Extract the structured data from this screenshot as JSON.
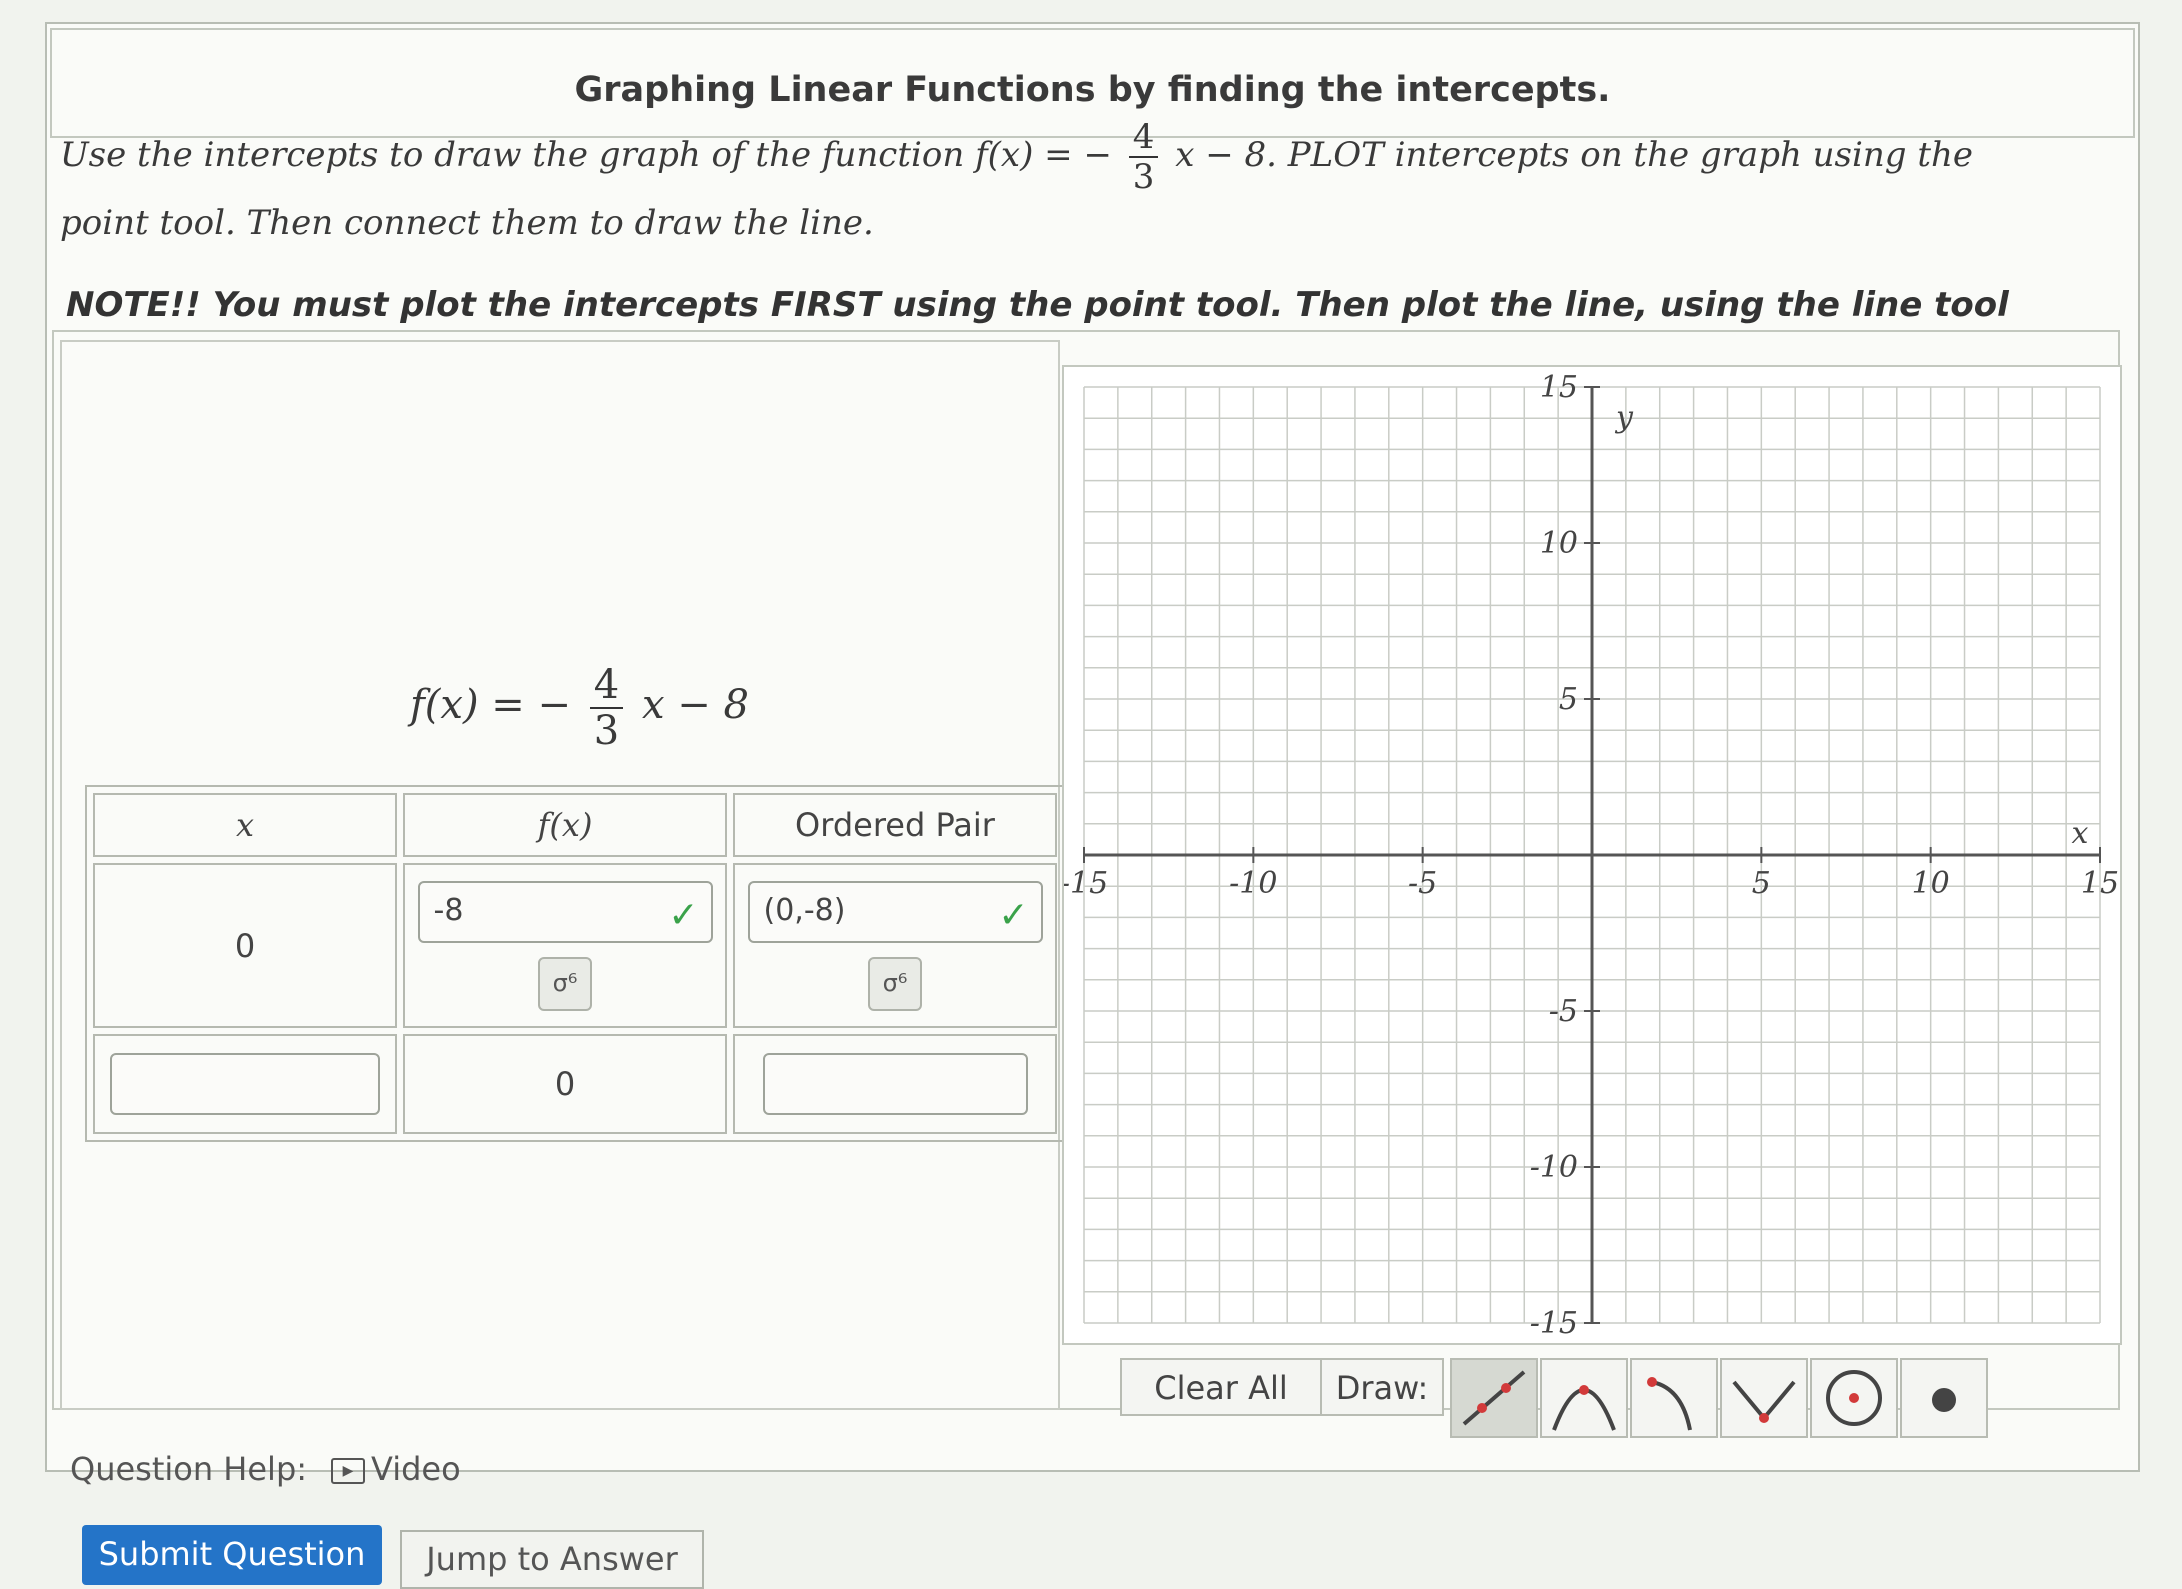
{
  "header": {
    "title": "Graphing Linear Functions by finding the intercepts."
  },
  "instructions": {
    "part1": "Use the intercepts to draw the graph of the function",
    "fx": "f(x) =",
    "minus": "−",
    "num": "4",
    "den": "3",
    "xterm": "x − 8",
    "part2": ". PLOT intercepts on the graph using the point tool. Then connect them to draw the line."
  },
  "note": "NOTE!! You must plot the intercepts FIRST using the point tool. Then plot the line, using the line tool",
  "function_display": {
    "lhs": "f(x) = −",
    "num": "4",
    "den": "3",
    "rhs": "x − 8"
  },
  "table": {
    "headers": [
      "x",
      "f(x)",
      "Ordered Pair"
    ],
    "row1": {
      "x": "0",
      "fx": "-8",
      "pair": "(0,-8)"
    },
    "row2": {
      "x": "",
      "fx": "0",
      "pair": ""
    },
    "key_icon": "σ⁶"
  },
  "graph": {
    "x_label": "x",
    "y_label": "y",
    "range": [
      -15,
      15
    ],
    "ticks_x": [
      "-15",
      "-10",
      "-5",
      "5",
      "10",
      "15"
    ],
    "ticks_y": [
      "15",
      "10",
      "5",
      "-5",
      "-10",
      "-15"
    ]
  },
  "toolbar": {
    "clear_all": "Clear All",
    "draw_label": "Draw:",
    "tools": [
      "line-tool",
      "parabola-tool",
      "sqrt-tool",
      "absolute-value-tool",
      "circle-tool",
      "point-tool"
    ]
  },
  "help": {
    "label": "Question Help:",
    "video": "Video"
  },
  "buttons": {
    "submit": "Submit Question",
    "jump": "Jump to Answer"
  },
  "colors": {
    "check": "#3aa24a",
    "submit": "#2474c8",
    "tool_red": "#d23a3a"
  }
}
